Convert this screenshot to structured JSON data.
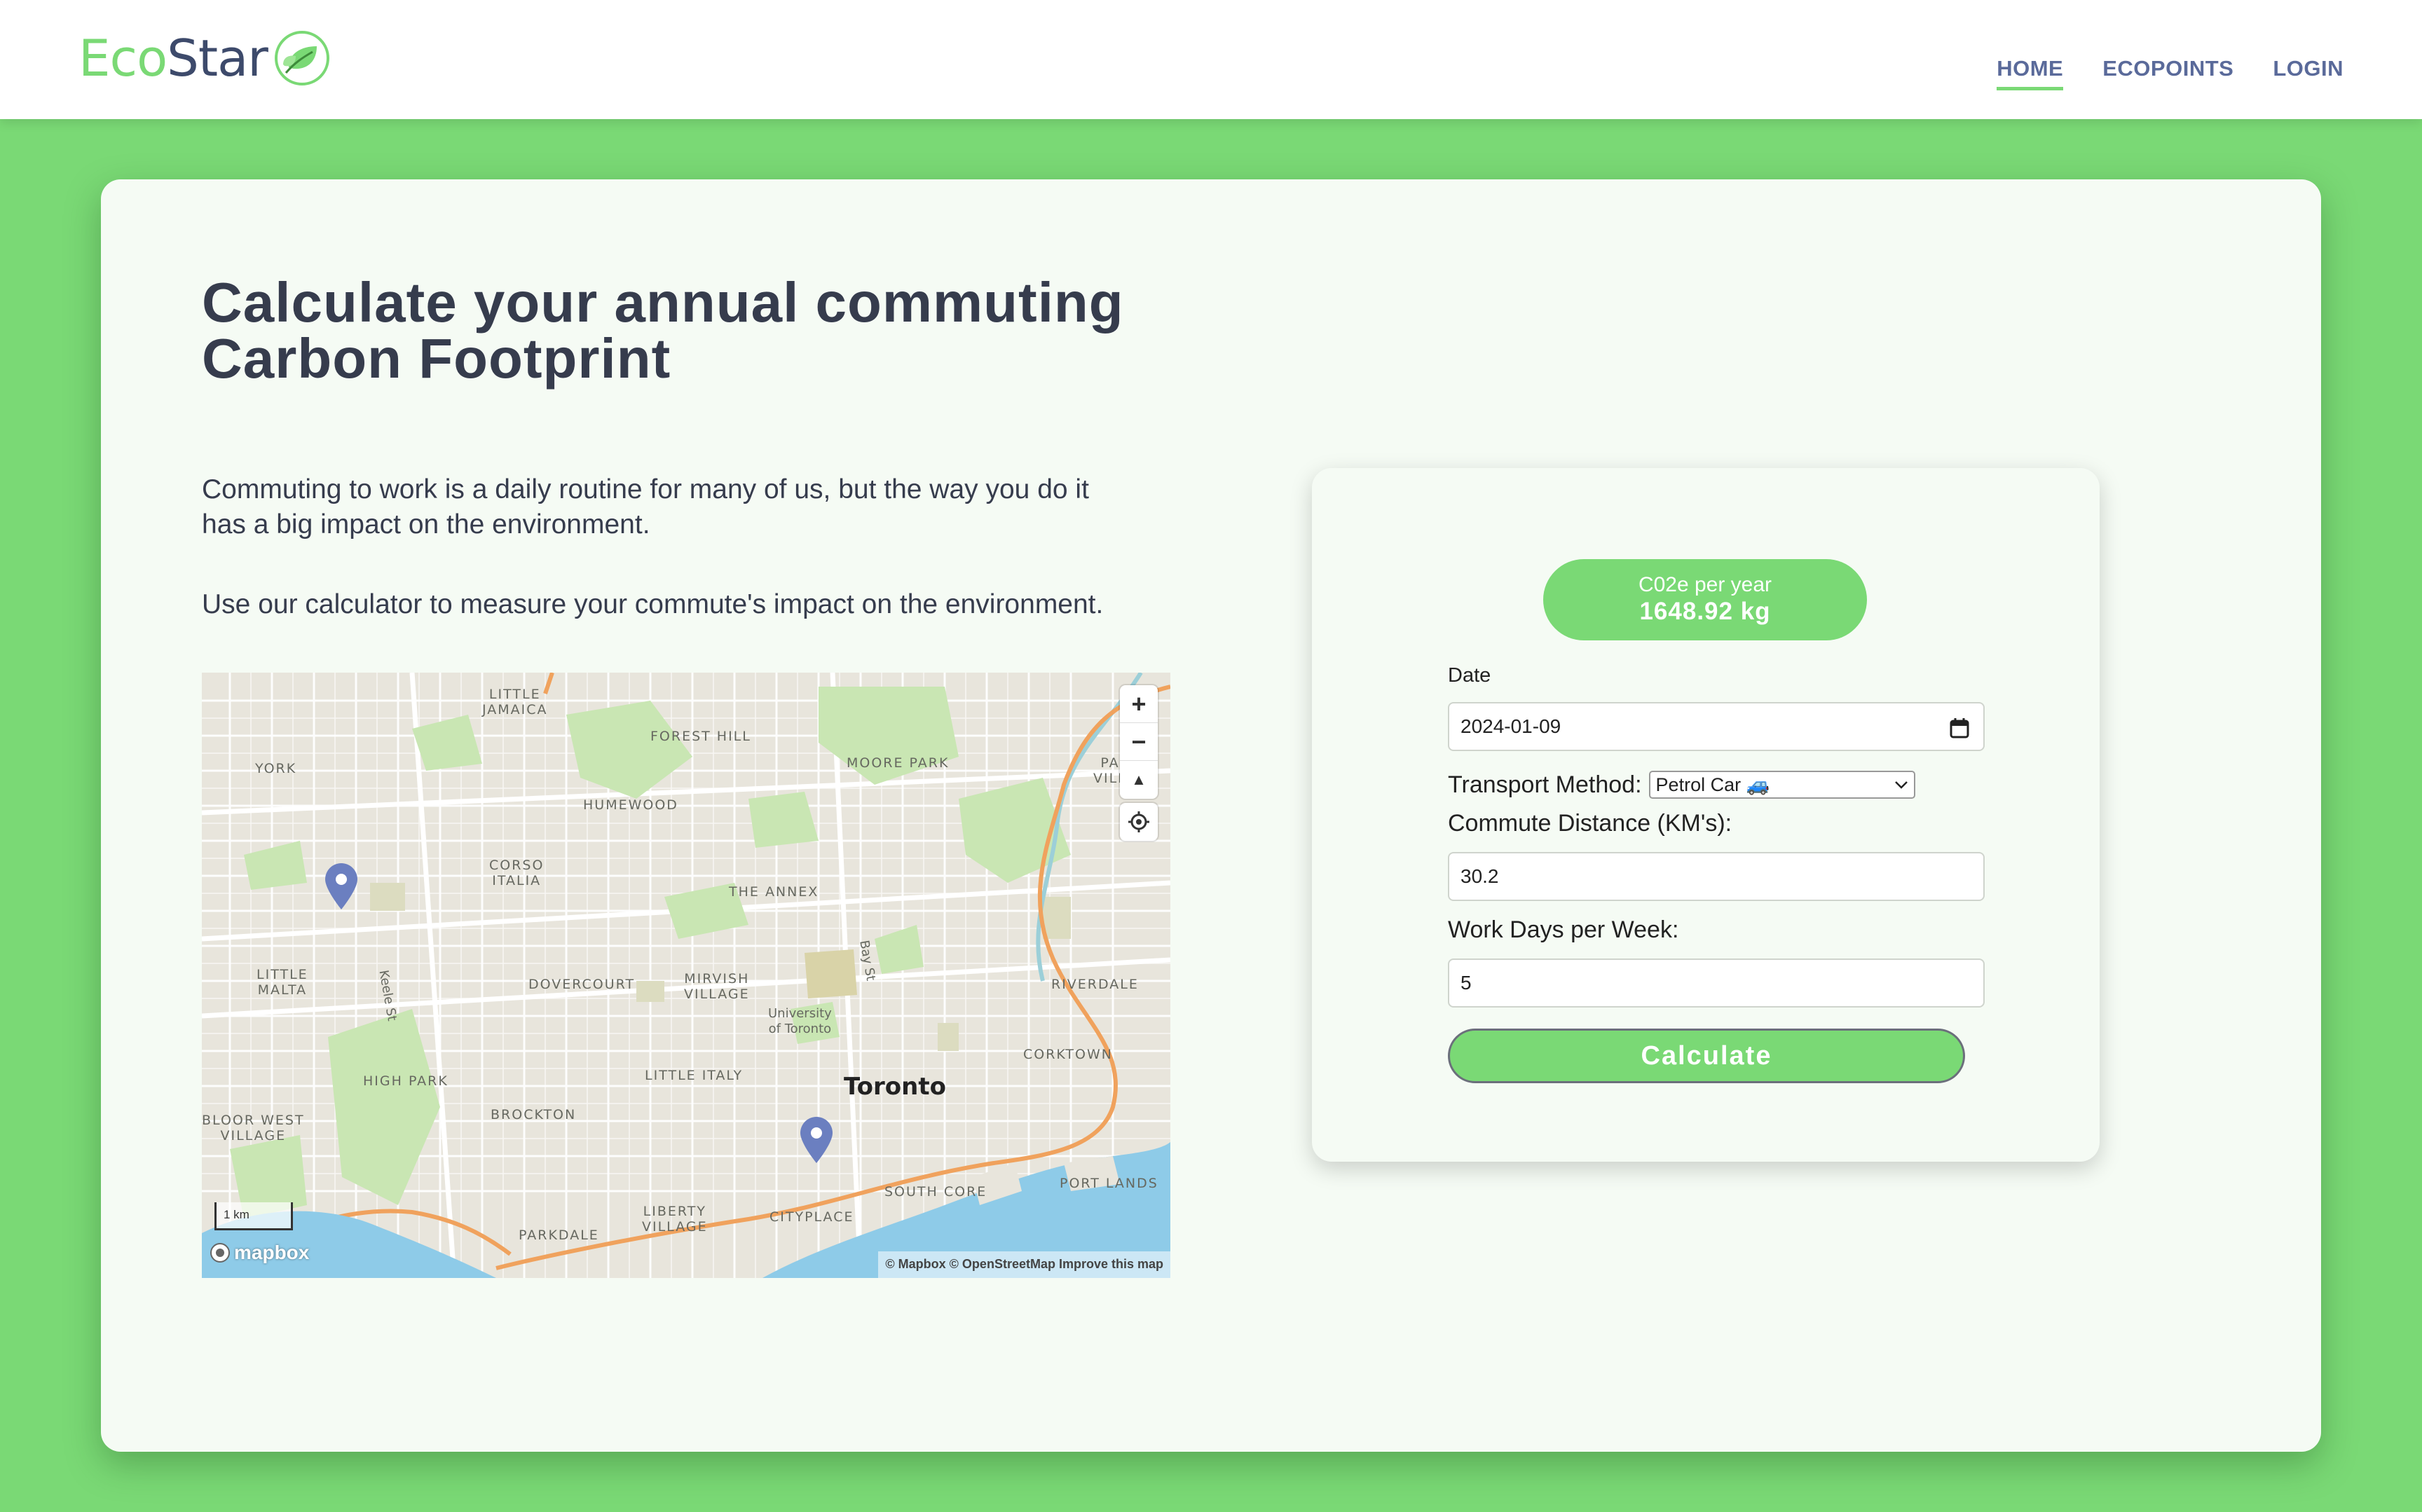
{
  "brand": {
    "eco": "Eco",
    "star": "Star",
    "icon": "leaf-icon"
  },
  "nav": [
    {
      "label": "HOME",
      "active": true
    },
    {
      "label": "ECOPOINTS",
      "active": false
    },
    {
      "label": "LOGIN",
      "active": false
    }
  ],
  "hero": {
    "title_line1": "Calculate your annual commuting",
    "title_line2": "Carbon Footprint",
    "paragraph1": "Commuting to work is a daily routine for many of us, but the way you do it has a big impact on the environment.",
    "paragraph2": "Use our calculator to measure your commute's impact on the environment."
  },
  "map": {
    "labels": {
      "little_jamaica": "LITTLE\nJAMAICA",
      "forest_hill": "FOREST HILL",
      "moore_park": "MOORE PARK",
      "york": "YORK",
      "humewood": "HUMEWOOD",
      "corso_italia": "CORSO\nITALIA",
      "the_annex": "THE ANNEX",
      "little_malta": "LITTLE\nMALTA",
      "dovercourt": "DOVERCOURT",
      "mirvish_village": "MIRVISH\nVILLAGE",
      "riverdale": "RIVERDALE",
      "keele_st": "Keele St",
      "bay_st": "Bay St",
      "university": "University\nof Toronto",
      "corktown": "CORKTOWN",
      "high_park": "HIGH PARK",
      "little_italy": "LITTLE ITALY",
      "toronto": "Toronto",
      "brockton": "BROCKTON",
      "bloor_west": "BLOOR WEST\nVILLAGE",
      "port_lands": "PORT LANDS",
      "south_core": "SOUTH CORE",
      "liberty_village": "LIBERTY\nVILLAGE",
      "cityplace": "CITYPLACE",
      "parkdale": "PARKDALE",
      "par_villa": "PAR\nVILLA"
    },
    "zoom_in": "+",
    "zoom_out": "−",
    "compass": "▲",
    "scale": "1 km",
    "provider": "mapbox",
    "attribution": "© Mapbox © OpenStreetMap  Improve this map",
    "pin_color": "#6b7fc0"
  },
  "calculator": {
    "result_label": "C02e per year",
    "result_value": "1648.92 kg",
    "date_label": "Date",
    "date_value": "2024-01-09",
    "transport_label": "Transport Method:",
    "transport_value": "Petrol Car 🚙",
    "distance_label": "Commute Distance (KM's):",
    "distance_value": "30.2",
    "workdays_label": "Work Days per Week:",
    "workdays_value": "5",
    "button_label": "Calculate"
  },
  "colors": {
    "accent": "#7ad975",
    "text": "#363c4d",
    "nav": "#5a6a9a"
  }
}
